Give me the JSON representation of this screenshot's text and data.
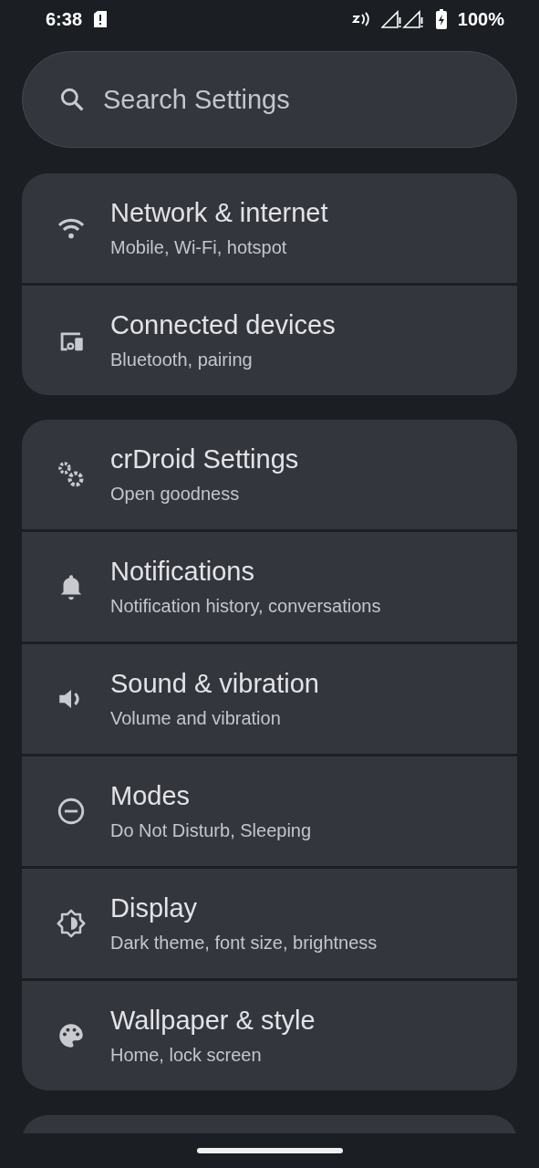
{
  "status_bar": {
    "time": "6:38",
    "battery": "100%"
  },
  "search": {
    "placeholder": "Search Settings"
  },
  "groups": [
    {
      "items": [
        {
          "kind": "wifi",
          "title": "Network & internet",
          "subtitle": "Mobile, Wi-Fi, hotspot"
        },
        {
          "kind": "devices",
          "title": "Connected devices",
          "subtitle": "Bluetooth, pairing"
        }
      ]
    },
    {
      "items": [
        {
          "kind": "gears",
          "title": "crDroid Settings",
          "subtitle": "Open goodness"
        },
        {
          "kind": "bell",
          "title": "Notifications",
          "subtitle": "Notification history, conversations"
        },
        {
          "kind": "sound",
          "title": "Sound & vibration",
          "subtitle": "Volume and vibration"
        },
        {
          "kind": "modes",
          "title": "Modes",
          "subtitle": "Do Not Disturb, Sleeping"
        },
        {
          "kind": "display",
          "title": "Display",
          "subtitle": "Dark theme, font size, brightness"
        },
        {
          "kind": "palette",
          "title": "Wallpaper & style",
          "subtitle": "Home, lock screen"
        }
      ]
    }
  ]
}
